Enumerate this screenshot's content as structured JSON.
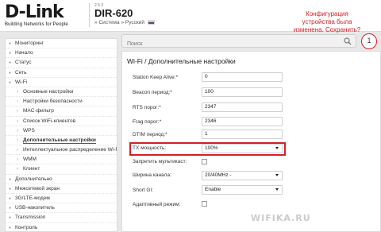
{
  "header": {
    "logo": "D-Link",
    "logo_tagline": "Building Networks for People",
    "version": "2.5.3",
    "model": "DIR-620",
    "subline_prefix": "»",
    "subline_system": "Система",
    "subline_language": "Русский",
    "notice": "Конфигурация устройства была изменена. Сохранить?"
  },
  "search": {
    "placeholder": "Поиск"
  },
  "badge": "1",
  "sidebar": {
    "items": [
      {
        "label": "Мониторинг",
        "level": 0
      },
      {
        "label": "Начало",
        "level": 0
      },
      {
        "label": "Статус",
        "level": 0
      },
      {
        "label": "Сеть",
        "level": 0
      },
      {
        "label": "Wi-Fi",
        "level": 0
      },
      {
        "label": "Основные настройки",
        "level": 1
      },
      {
        "label": "Настройки безопасности",
        "level": 1
      },
      {
        "label": "MAC-фильтр",
        "level": 1
      },
      {
        "label": "Список WiFi-клиентов",
        "level": 1
      },
      {
        "label": "WPS",
        "level": 1
      },
      {
        "label": "Дополнительные настройки",
        "level": 1
      },
      {
        "label": "Интеллектуальное распределение Wi-Fi",
        "level": 1
      },
      {
        "label": "WMM",
        "level": 1
      },
      {
        "label": "Клиент",
        "level": 1
      },
      {
        "label": "Дополнительно",
        "level": 0
      },
      {
        "label": "Межсетевой экран",
        "level": 0
      },
      {
        "label": "3G/LTE-модем",
        "level": 0
      },
      {
        "label": "USB-накопитель",
        "level": 0
      },
      {
        "label": "Transmission",
        "level": 0
      },
      {
        "label": "Контроль",
        "level": 0
      }
    ]
  },
  "main": {
    "title": "Wi-Fi /  Дополнительные настройки",
    "fields": {
      "station_keep_alive": {
        "label": "Station Keep Alive:*",
        "value": "0"
      },
      "beacon_period": {
        "label": "Beacon период:*",
        "value": "100"
      },
      "rts_threshold": {
        "label": "RTS порог:*",
        "value": "2347"
      },
      "frag_threshold": {
        "label": "Frag порог:*",
        "value": "2346"
      },
      "dtim_period": {
        "label": "DTIM период:*",
        "value": "1"
      },
      "tx_power": {
        "label": "TX мощность:",
        "value": "100%"
      },
      "block_multicast": {
        "label": "Запретить мультикаст:",
        "checked": false
      },
      "channel_width": {
        "label": "Ширина канала:",
        "value": "20/40MHz -"
      },
      "short_gi": {
        "label": "Short GI:",
        "value": "Enable"
      },
      "adaptive_mode": {
        "label": "Адаптивный режим:",
        "checked": false
      }
    }
  },
  "watermark": "WIFIKA.RU",
  "colors": {
    "accent": "#d32027",
    "background": "#e8e8e8",
    "panel": "#ffffff"
  },
  "icons": [
    "search-icon"
  ]
}
